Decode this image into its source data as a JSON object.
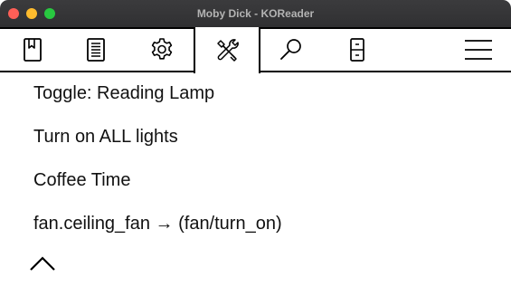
{
  "window": {
    "title": "Moby Dick - KOReader"
  },
  "tabs": [
    {
      "name": "bookmark",
      "icon": "bookmark-icon"
    },
    {
      "name": "document",
      "icon": "document-icon"
    },
    {
      "name": "settings",
      "icon": "gear-icon"
    },
    {
      "name": "tools",
      "icon": "tools-icon",
      "active": true
    },
    {
      "name": "search",
      "icon": "search-icon"
    },
    {
      "name": "navigation",
      "icon": "page-nav-icon"
    },
    {
      "name": "main-menu",
      "icon": "hamburger-icon"
    }
  ],
  "menu": {
    "items": [
      {
        "label": "Toggle: Reading Lamp"
      },
      {
        "label": "Turn on ALL lights"
      },
      {
        "label": "Coffee Time"
      },
      {
        "label": "fan.ceiling_fan → (fan/turn_on)"
      }
    ],
    "back_icon": "chevron-up-icon"
  },
  "colors": {
    "titlebar_bg": "#363638",
    "title_text": "#b3b3b3",
    "close": "#fe5f57",
    "minimize": "#febc2e",
    "maximize": "#28c840",
    "text": "#111111"
  }
}
